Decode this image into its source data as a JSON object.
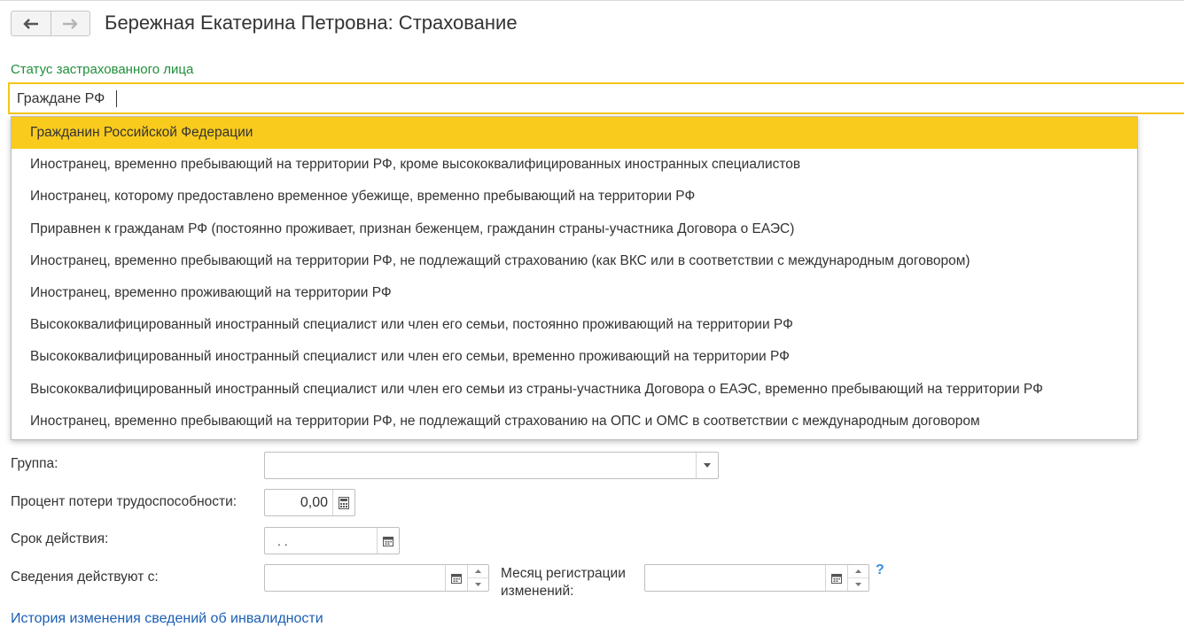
{
  "header": {
    "title": "Бережная Екатерина Петровна: Страхование"
  },
  "status": {
    "label": "Статус застрахованного лица",
    "input_value": "Граждане РФ"
  },
  "dropdown": {
    "items": [
      "Гражданин Российской Федерации",
      "Иностранец, временно пребывающий на территории РФ, кроме высококвалифицированных иностранных специалистов",
      "Иностранец, которому предоставлено временное убежище, временно пребывающий на территории РФ",
      "Приравнен к гражданам РФ (постоянно проживает, признан беженцем, гражданин страны-участника Договора о ЕАЭС)",
      "Иностранец, временно пребывающий на территории РФ, не подлежащий страхованию (как ВКС или в соответствии с международным договором)",
      "Иностранец, временно проживающий на территории РФ",
      "Высококвалифицированный иностранный специалист или член его семьи, постоянно проживающий на территории РФ",
      "Высококвалифицированный иностранный специалист или член его семьи, временно проживающий на территории РФ",
      "Высококвалифицированный иностранный специалист или член его семьи из страны-участника Договора о ЕАЭС, временно пребывающий на территории РФ",
      "Иностранец, временно пребывающий на территории РФ, не подлежащий страхованию на ОПС и ОМС в соответствии с международным договором"
    ],
    "selected_index": 0
  },
  "form": {
    "group_label": "Группа:",
    "group_value": "",
    "percent_label": "Процент потери трудоспособности:",
    "percent_value": "0,00",
    "term_label": "Срок действия:",
    "term_value": " .  .",
    "effective_label": "Сведения действуют с:",
    "effective_value": "",
    "reg_month_label_line1": "Месяц регистрации",
    "reg_month_label_line2": "изменений:",
    "reg_month_value": "",
    "help": "?"
  },
  "history_link": "История изменения сведений об инвалидности",
  "colors": {
    "accent_yellow": "#f9cb1d",
    "label_green": "#1f8f3a",
    "link_blue": "#1a5fb4",
    "help_blue": "#3a8dde"
  }
}
